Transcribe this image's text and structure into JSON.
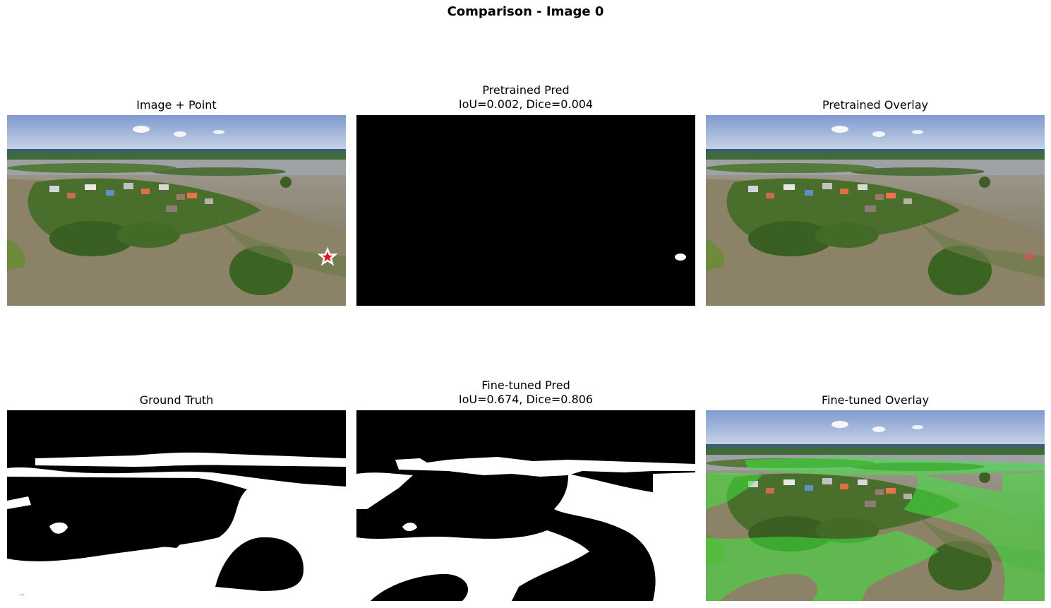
{
  "figure": {
    "title": "Comparison - Image 0"
  },
  "panels": {
    "image_point": {
      "title": "Image + Point"
    },
    "pretrained_pred": {
      "title_line1": "Pretrained Pred",
      "title_line2": "IoU=0.002, Dice=0.004",
      "iou": 0.002,
      "dice": 0.004
    },
    "pretrained_overlay": {
      "title": "Pretrained Overlay"
    },
    "ground_truth": {
      "title": "Ground Truth"
    },
    "finetuned_pred": {
      "title_line1": "Fine-tuned Pred",
      "title_line2": "IoU=0.674, Dice=0.806",
      "iou": 0.674,
      "dice": 0.806
    },
    "finetuned_overlay": {
      "title": "Fine-tuned Overlay"
    }
  },
  "colors": {
    "point_marker": "#e8141c",
    "finetuned_overlay": "#3ee63e",
    "pretrained_overlay": "#e05050"
  }
}
